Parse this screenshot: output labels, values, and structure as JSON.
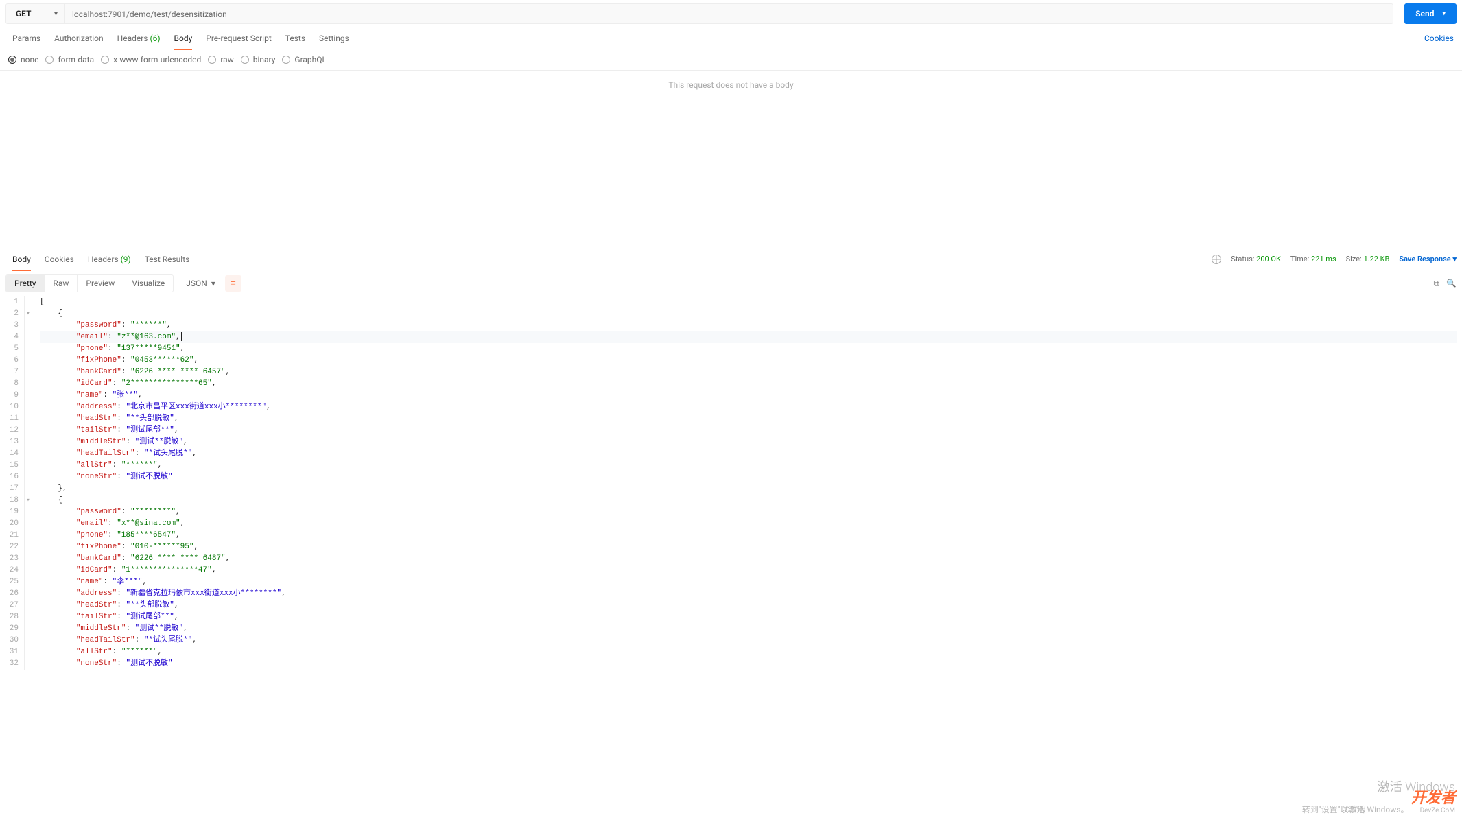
{
  "request": {
    "method": "GET",
    "url": "localhost:7901/demo/test/desensitization",
    "send_label": "Send"
  },
  "req_tabs": {
    "params": "Params",
    "authorization": "Authorization",
    "headers": "Headers",
    "headers_count": "(6)",
    "body": "Body",
    "prerequest": "Pre-request Script",
    "tests": "Tests",
    "settings": "Settings",
    "cookies_link": "Cookies"
  },
  "body_types": {
    "none": "none",
    "formdata": "form-data",
    "xform": "x-www-form-urlencoded",
    "raw": "raw",
    "binary": "binary",
    "graphql": "GraphQL",
    "empty_msg": "This request does not have a body"
  },
  "resp_tabs": {
    "body": "Body",
    "cookies": "Cookies",
    "headers": "Headers",
    "headers_count": "(9)",
    "test_results": "Test Results"
  },
  "resp_meta": {
    "status_label": "Status:",
    "status_value": "200 OK",
    "time_label": "Time:",
    "time_value": "221 ms",
    "size_label": "Size:",
    "size_value": "1.22 KB",
    "save": "Save Response"
  },
  "view_tabs": {
    "pretty": "Pretty",
    "raw": "Raw",
    "preview": "Preview",
    "visualize": "Visualize",
    "format": "JSON"
  },
  "json_lines": [
    {
      "n": 1,
      "indent": 0,
      "tokens": [
        {
          "t": "br",
          "v": "["
        }
      ]
    },
    {
      "n": 2,
      "indent": 1,
      "tokens": [
        {
          "t": "br",
          "v": "{"
        }
      ],
      "fold": true
    },
    {
      "n": 3,
      "indent": 2,
      "tokens": [
        {
          "t": "k",
          "v": "\"password\""
        },
        {
          "t": "p",
          "v": ": "
        },
        {
          "t": "s",
          "v": "\"******\""
        },
        {
          "t": "p",
          "v": ","
        }
      ]
    },
    {
      "n": 4,
      "indent": 2,
      "hl": true,
      "cursor": true,
      "tokens": [
        {
          "t": "k",
          "v": "\"email\""
        },
        {
          "t": "p",
          "v": ": "
        },
        {
          "t": "s",
          "v": "\"z**@163.com\""
        },
        {
          "t": "p",
          "v": ","
        }
      ]
    },
    {
      "n": 5,
      "indent": 2,
      "tokens": [
        {
          "t": "k",
          "v": "\"phone\""
        },
        {
          "t": "p",
          "v": ": "
        },
        {
          "t": "s",
          "v": "\"137*****9451\""
        },
        {
          "t": "p",
          "v": ","
        }
      ]
    },
    {
      "n": 6,
      "indent": 2,
      "tokens": [
        {
          "t": "k",
          "v": "\"fixPhone\""
        },
        {
          "t": "p",
          "v": ": "
        },
        {
          "t": "s",
          "v": "\"0453******62\""
        },
        {
          "t": "p",
          "v": ","
        }
      ]
    },
    {
      "n": 7,
      "indent": 2,
      "tokens": [
        {
          "t": "k",
          "v": "\"bankCard\""
        },
        {
          "t": "p",
          "v": ": "
        },
        {
          "t": "s",
          "v": "\"6226 **** **** 6457\""
        },
        {
          "t": "p",
          "v": ","
        }
      ]
    },
    {
      "n": 8,
      "indent": 2,
      "tokens": [
        {
          "t": "k",
          "v": "\"idCard\""
        },
        {
          "t": "p",
          "v": ": "
        },
        {
          "t": "s",
          "v": "\"2***************65\""
        },
        {
          "t": "p",
          "v": ","
        }
      ]
    },
    {
      "n": 9,
      "indent": 2,
      "tokens": [
        {
          "t": "k",
          "v": "\"name\""
        },
        {
          "t": "p",
          "v": ": "
        },
        {
          "t": "s2",
          "v": "\"张**\""
        },
        {
          "t": "p",
          "v": ","
        }
      ]
    },
    {
      "n": 10,
      "indent": 2,
      "tokens": [
        {
          "t": "k",
          "v": "\"address\""
        },
        {
          "t": "p",
          "v": ": "
        },
        {
          "t": "s2",
          "v": "\"北京市昌平区xxx街道xxx小********\""
        },
        {
          "t": "p",
          "v": ","
        }
      ]
    },
    {
      "n": 11,
      "indent": 2,
      "tokens": [
        {
          "t": "k",
          "v": "\"headStr\""
        },
        {
          "t": "p",
          "v": ": "
        },
        {
          "t": "s2",
          "v": "\"**头部脱敏\""
        },
        {
          "t": "p",
          "v": ","
        }
      ]
    },
    {
      "n": 12,
      "indent": 2,
      "tokens": [
        {
          "t": "k",
          "v": "\"tailStr\""
        },
        {
          "t": "p",
          "v": ": "
        },
        {
          "t": "s2",
          "v": "\"测试尾部**\""
        },
        {
          "t": "p",
          "v": ","
        }
      ]
    },
    {
      "n": 13,
      "indent": 2,
      "tokens": [
        {
          "t": "k",
          "v": "\"middleStr\""
        },
        {
          "t": "p",
          "v": ": "
        },
        {
          "t": "s2",
          "v": "\"测试**脱敏\""
        },
        {
          "t": "p",
          "v": ","
        }
      ]
    },
    {
      "n": 14,
      "indent": 2,
      "tokens": [
        {
          "t": "k",
          "v": "\"headTailStr\""
        },
        {
          "t": "p",
          "v": ": "
        },
        {
          "t": "s2",
          "v": "\"*试头尾脱*\""
        },
        {
          "t": "p",
          "v": ","
        }
      ]
    },
    {
      "n": 15,
      "indent": 2,
      "tokens": [
        {
          "t": "k",
          "v": "\"allStr\""
        },
        {
          "t": "p",
          "v": ": "
        },
        {
          "t": "s",
          "v": "\"******\""
        },
        {
          "t": "p",
          "v": ","
        }
      ]
    },
    {
      "n": 16,
      "indent": 2,
      "tokens": [
        {
          "t": "k",
          "v": "\"noneStr\""
        },
        {
          "t": "p",
          "v": ": "
        },
        {
          "t": "s2",
          "v": "\"测试不脱敏\""
        }
      ]
    },
    {
      "n": 17,
      "indent": 1,
      "tokens": [
        {
          "t": "br",
          "v": "},"
        }
      ]
    },
    {
      "n": 18,
      "indent": 1,
      "tokens": [
        {
          "t": "br",
          "v": "{"
        }
      ],
      "fold": true
    },
    {
      "n": 19,
      "indent": 2,
      "tokens": [
        {
          "t": "k",
          "v": "\"password\""
        },
        {
          "t": "p",
          "v": ": "
        },
        {
          "t": "s",
          "v": "\"********\""
        },
        {
          "t": "p",
          "v": ","
        }
      ]
    },
    {
      "n": 20,
      "indent": 2,
      "tokens": [
        {
          "t": "k",
          "v": "\"email\""
        },
        {
          "t": "p",
          "v": ": "
        },
        {
          "t": "s",
          "v": "\"x**@sina.com\""
        },
        {
          "t": "p",
          "v": ","
        }
      ]
    },
    {
      "n": 21,
      "indent": 2,
      "tokens": [
        {
          "t": "k",
          "v": "\"phone\""
        },
        {
          "t": "p",
          "v": ": "
        },
        {
          "t": "s",
          "v": "\"185****6547\""
        },
        {
          "t": "p",
          "v": ","
        }
      ]
    },
    {
      "n": 22,
      "indent": 2,
      "tokens": [
        {
          "t": "k",
          "v": "\"fixPhone\""
        },
        {
          "t": "p",
          "v": ": "
        },
        {
          "t": "s",
          "v": "\"010-******95\""
        },
        {
          "t": "p",
          "v": ","
        }
      ]
    },
    {
      "n": 23,
      "indent": 2,
      "tokens": [
        {
          "t": "k",
          "v": "\"bankCard\""
        },
        {
          "t": "p",
          "v": ": "
        },
        {
          "t": "s",
          "v": "\"6226 **** **** 6487\""
        },
        {
          "t": "p",
          "v": ","
        }
      ]
    },
    {
      "n": 24,
      "indent": 2,
      "tokens": [
        {
          "t": "k",
          "v": "\"idCard\""
        },
        {
          "t": "p",
          "v": ": "
        },
        {
          "t": "s",
          "v": "\"1***************47\""
        },
        {
          "t": "p",
          "v": ","
        }
      ]
    },
    {
      "n": 25,
      "indent": 2,
      "tokens": [
        {
          "t": "k",
          "v": "\"name\""
        },
        {
          "t": "p",
          "v": ": "
        },
        {
          "t": "s2",
          "v": "\"李***\""
        },
        {
          "t": "p",
          "v": ","
        }
      ]
    },
    {
      "n": 26,
      "indent": 2,
      "tokens": [
        {
          "t": "k",
          "v": "\"address\""
        },
        {
          "t": "p",
          "v": ": "
        },
        {
          "t": "s2",
          "v": "\"新疆省克拉玛依市xxx街道xxx小********\""
        },
        {
          "t": "p",
          "v": ","
        }
      ]
    },
    {
      "n": 27,
      "indent": 2,
      "tokens": [
        {
          "t": "k",
          "v": "\"headStr\""
        },
        {
          "t": "p",
          "v": ": "
        },
        {
          "t": "s2",
          "v": "\"**头部脱敏\""
        },
        {
          "t": "p",
          "v": ","
        }
      ]
    },
    {
      "n": 28,
      "indent": 2,
      "tokens": [
        {
          "t": "k",
          "v": "\"tailStr\""
        },
        {
          "t": "p",
          "v": ": "
        },
        {
          "t": "s2",
          "v": "\"测试尾部**\""
        },
        {
          "t": "p",
          "v": ","
        }
      ]
    },
    {
      "n": 29,
      "indent": 2,
      "tokens": [
        {
          "t": "k",
          "v": "\"middleStr\""
        },
        {
          "t": "p",
          "v": ": "
        },
        {
          "t": "s2",
          "v": "\"测试**脱敏\""
        },
        {
          "t": "p",
          "v": ","
        }
      ]
    },
    {
      "n": 30,
      "indent": 2,
      "tokens": [
        {
          "t": "k",
          "v": "\"headTailStr\""
        },
        {
          "t": "p",
          "v": ": "
        },
        {
          "t": "s2",
          "v": "\"*试头尾脱*\""
        },
        {
          "t": "p",
          "v": ","
        }
      ]
    },
    {
      "n": 31,
      "indent": 2,
      "tokens": [
        {
          "t": "k",
          "v": "\"allStr\""
        },
        {
          "t": "p",
          "v": ": "
        },
        {
          "t": "s",
          "v": "\"******\""
        },
        {
          "t": "p",
          "v": ","
        }
      ]
    },
    {
      "n": 32,
      "indent": 2,
      "tokens": [
        {
          "t": "k",
          "v": "\"noneStr\""
        },
        {
          "t": "p",
          "v": ": "
        },
        {
          "t": "s2",
          "v": "\"测试不脱敏\""
        }
      ]
    }
  ],
  "watermark": {
    "line1": "激活 Windows",
    "line2": "转到\"设置\"以激活 Windows。",
    "csdn": "CSDN",
    "brand": "开发者",
    "brand_sub": "DevZe.CoM"
  }
}
